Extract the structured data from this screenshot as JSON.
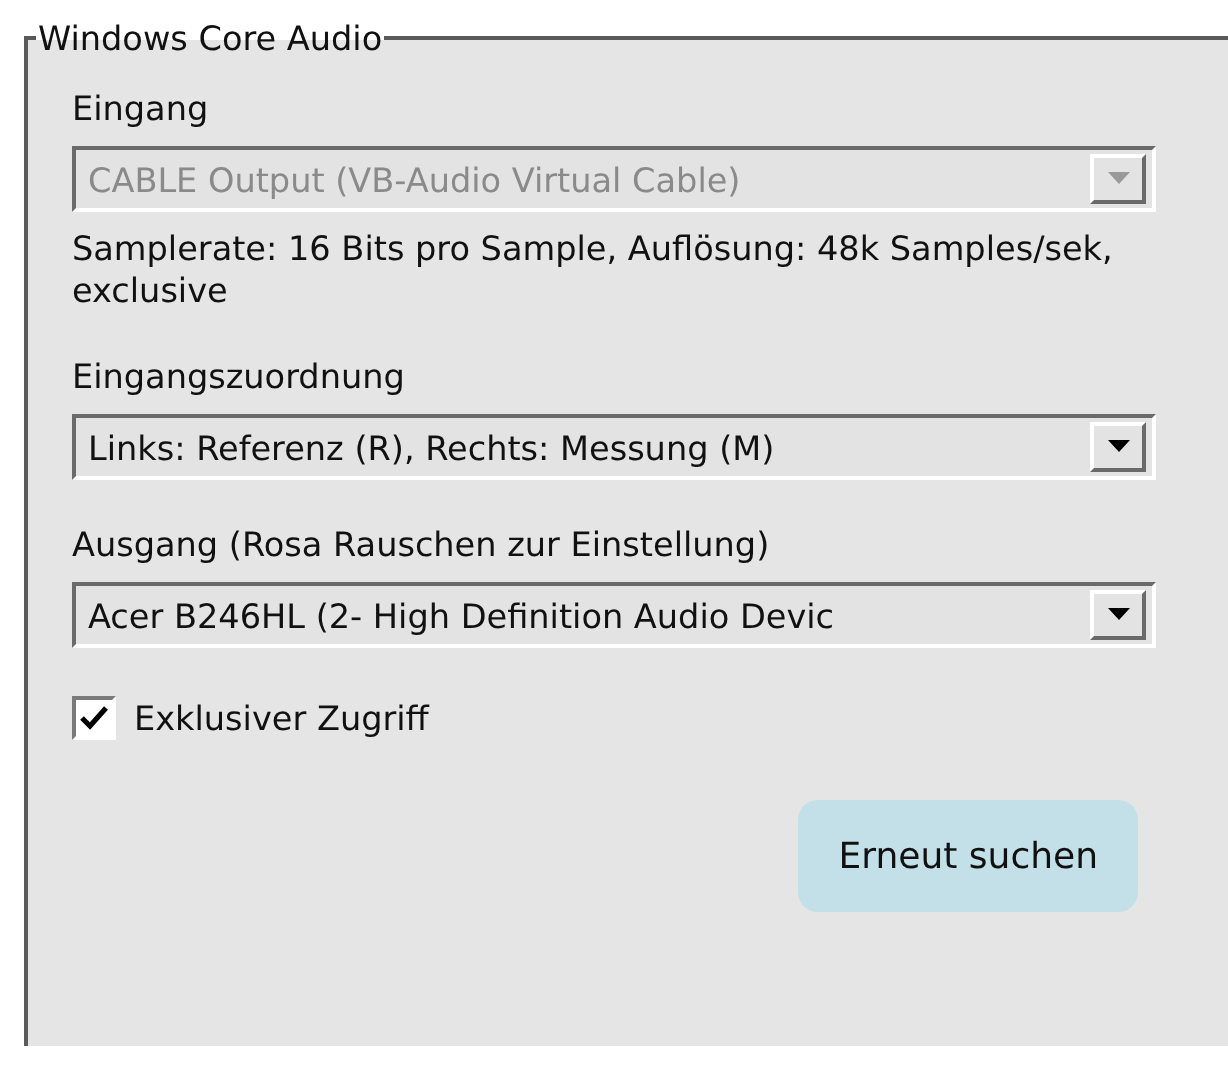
{
  "group": {
    "title": "Windows Core Audio"
  },
  "fields": [
    {
      "kind": "combo",
      "label": "Eingang",
      "value": "CABLE Output (VB-Audio Virtual Cable)",
      "disabled": true,
      "note": "Samplerate: 16 Bits pro Sample, Auflösung: 48k Samples/sek, exclusive"
    },
    {
      "kind": "combo",
      "label": "Eingangszuordnung",
      "value": "Links: Referenz (R), Rechts: Messung (M)",
      "disabled": false
    },
    {
      "kind": "combo",
      "label": "Ausgang (Rosa Rauschen zur Einstellung)",
      "value": "Acer B246HL (2- High Definition Audio Devic",
      "disabled": false
    },
    {
      "kind": "check",
      "label": "Exklusiver Zugriff",
      "checked": true
    }
  ],
  "button": {
    "label": "Erneut suchen"
  }
}
